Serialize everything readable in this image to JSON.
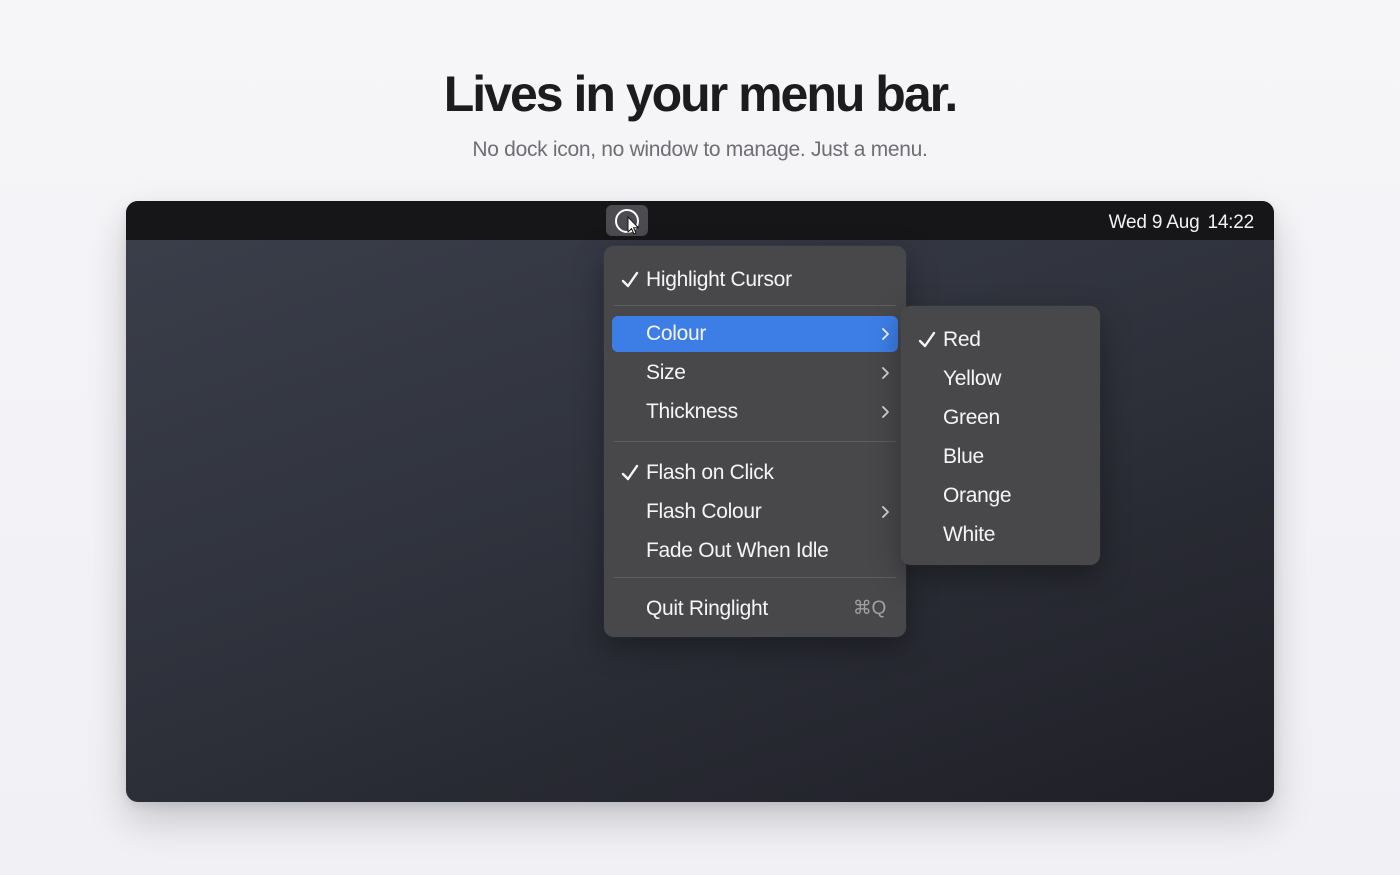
{
  "hero": {
    "title": "Lives in your menu bar.",
    "subtitle": "No dock icon, no window to manage. Just a menu."
  },
  "menubar": {
    "status_icon": "ring-cursor-icon",
    "date": "Wed 9 Aug",
    "time": "14:22"
  },
  "menu": {
    "items": [
      {
        "label": "Highlight Cursor",
        "checked": true
      },
      {
        "label": "Colour",
        "submenu": true,
        "highlighted": true
      },
      {
        "label": "Size",
        "submenu": true
      },
      {
        "label": "Thickness",
        "submenu": true
      },
      {
        "label": "Flash on Click",
        "checked": true
      },
      {
        "label": "Flash Colour",
        "submenu": true
      },
      {
        "label": "Fade Out When Idle"
      },
      {
        "label": "Quit Ringlight",
        "shortcut": "⌘Q"
      }
    ]
  },
  "colour_submenu": {
    "items": [
      {
        "label": "Red",
        "checked": true
      },
      {
        "label": "Yellow"
      },
      {
        "label": "Green"
      },
      {
        "label": "Blue"
      },
      {
        "label": "Orange"
      },
      {
        "label": "White"
      }
    ]
  },
  "colors": {
    "accent": "#3d7ee6",
    "menu_bg": "#48484b",
    "menubar_bg": "#161618"
  }
}
